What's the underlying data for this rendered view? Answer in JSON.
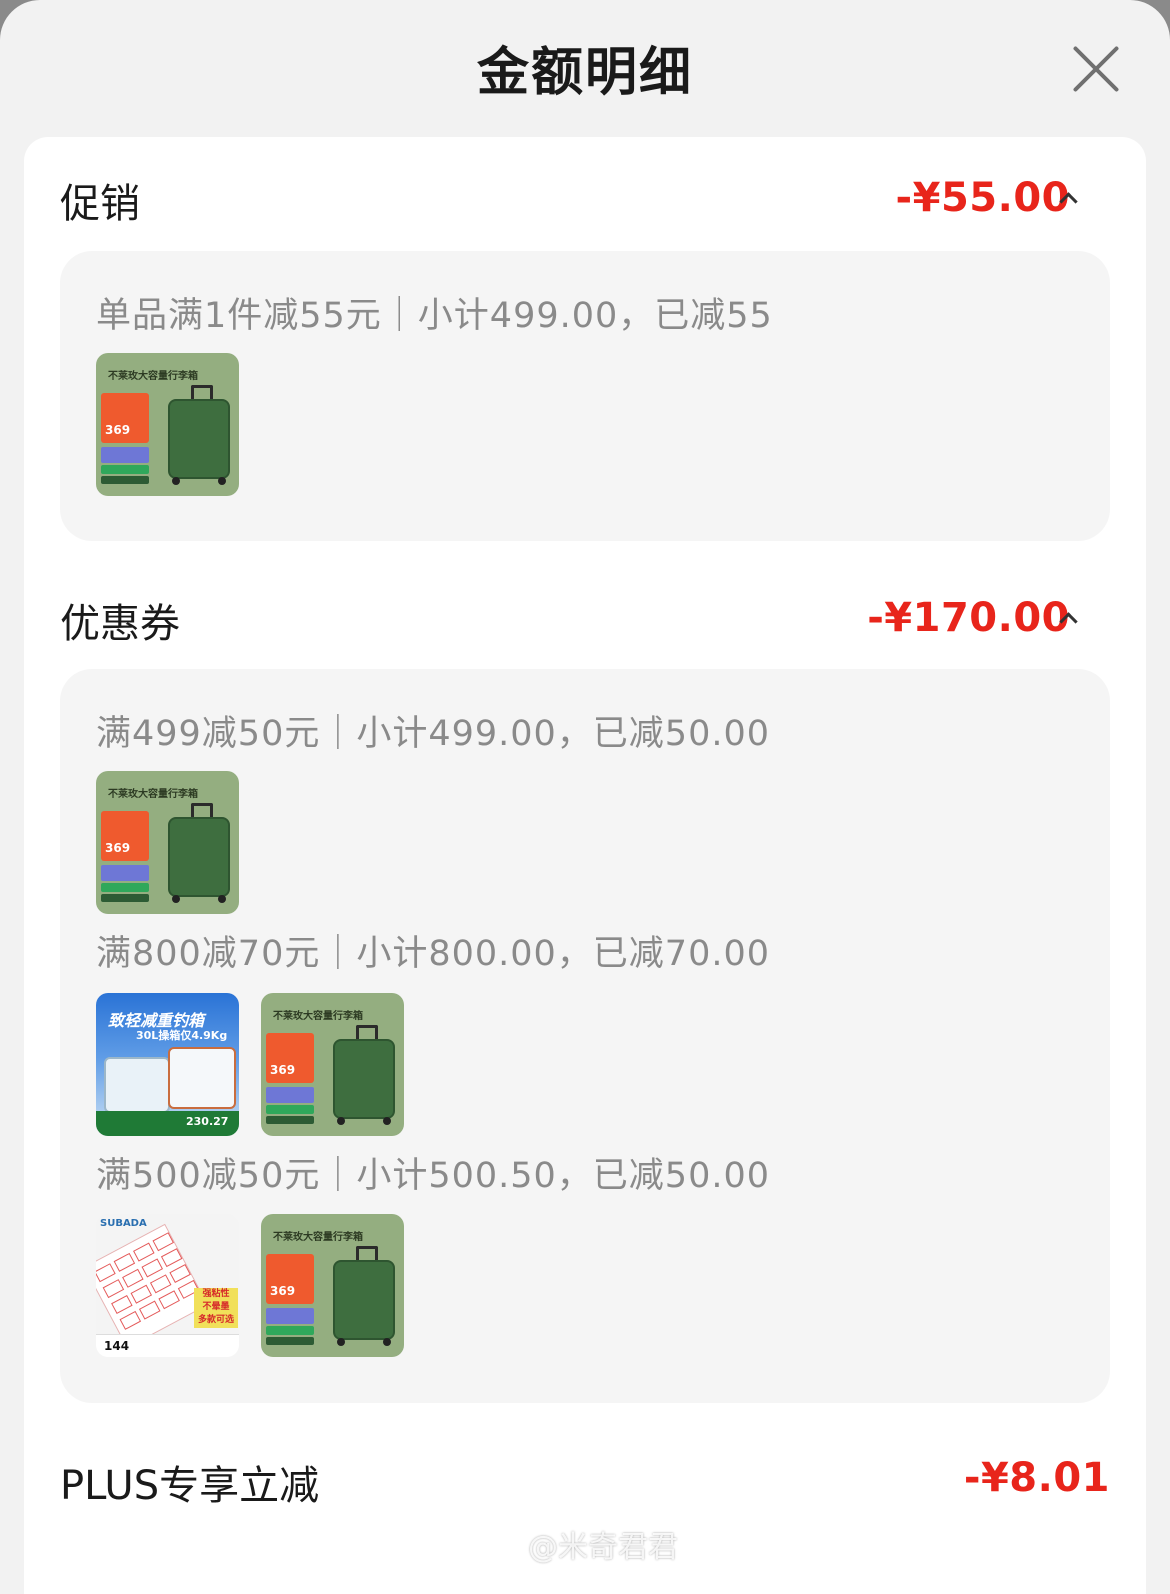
{
  "header": {
    "title": "金额明细"
  },
  "promotion": {
    "label": "促销",
    "amount": "-¥55.00",
    "rule": "单品满1件减55元｜小计499.00，已减55"
  },
  "coupon": {
    "label": "优惠券",
    "amount": "-¥170.00",
    "rows": [
      {
        "text": "满499减50元｜小计499.00，已减50.00"
      },
      {
        "text": "满800减70元｜小计800.00，已减70.00"
      },
      {
        "text": "满500减50元｜小计500.50，已减50.00"
      }
    ]
  },
  "plus": {
    "label": "PLUS专享立减",
    "amount": "-¥8.01"
  },
  "products": {
    "suitcase": {
      "banner": "不莱玫大容量行李箱",
      "price": "369"
    },
    "fishbox": {
      "title": "致轻减重钓箱",
      "subtitle": "30L操箱仅4.9Kg",
      "price": "230.27"
    },
    "labels": {
      "brand": "SUBADA",
      "tag_lines": [
        "强粘性",
        "不晕墨",
        "多款可选"
      ],
      "count": "144"
    }
  },
  "watermark": {
    "text": "@米奇君君"
  }
}
